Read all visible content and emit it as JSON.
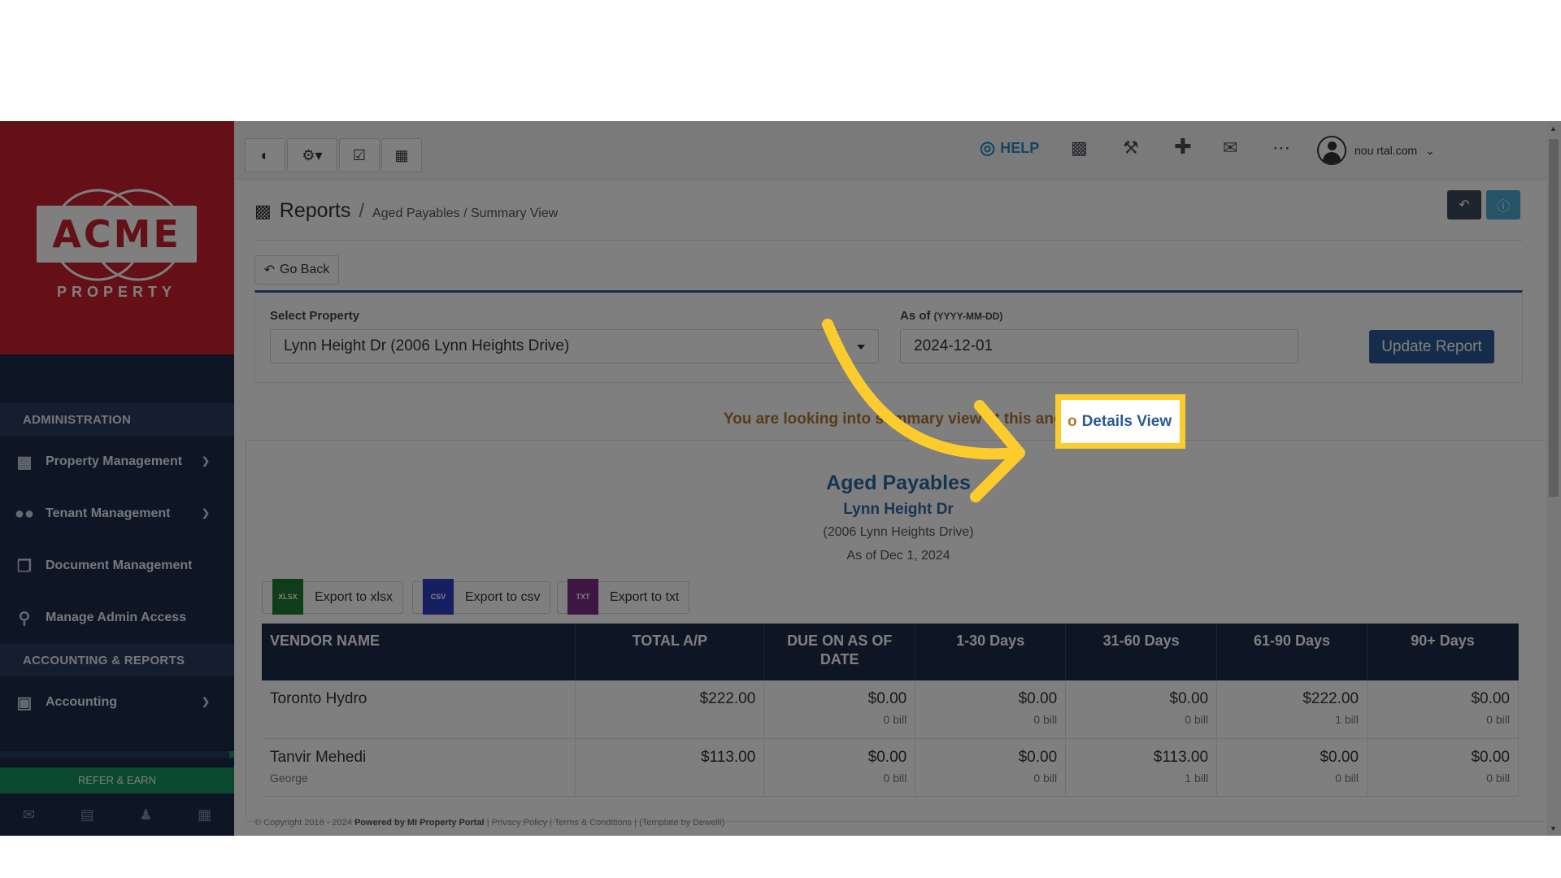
{
  "sidebar": {
    "logo_text": "ACME",
    "logo_sub": "PROPERTY",
    "section_admin": "ADMINISTRATION",
    "items_admin": [
      {
        "label": "Property Management",
        "icon": "building-icon",
        "expand": true
      },
      {
        "label": "Tenant Management",
        "icon": "users-icon",
        "expand": true
      },
      {
        "label": "Document Management",
        "icon": "documents-icon",
        "expand": false
      },
      {
        "label": "Manage Admin Access",
        "icon": "key-icon",
        "expand": false
      }
    ],
    "section_accounting": "ACCOUNTING & REPORTS",
    "items_accounting": [
      {
        "label": "Accounting",
        "icon": "money-icon",
        "expand": true
      }
    ],
    "refer_label": "REFER & EARN",
    "bottom_icons": [
      "mail-icon",
      "briefcase-icon",
      "user-icon",
      "calculator-icon"
    ]
  },
  "topbar": {
    "help_label": "HELP",
    "user_email_visible": "nou                        rtal.com"
  },
  "header": {
    "title": "Reports",
    "separator": "/",
    "crumb": "Aged Payables / Summary View"
  },
  "go_back_label": "Go Back",
  "filters": {
    "property_label": "Select Property",
    "property_value": "Lynn Height Dr (2006 Lynn Heights Drive)",
    "date_label": "As of",
    "date_hint": "(YYYY-MM-DD)",
    "date_value": "2024-12-01",
    "update_label": "Update Report"
  },
  "notice": {
    "text": "You are looking into summary view at this                  ange",
    "highlight_pre": "o",
    "highlight_link": "Details View"
  },
  "report": {
    "title": "Aged Payables",
    "property": "Lynn Height Dr",
    "address": "(2006 Lynn Heights Drive)",
    "as_of": "As of Dec 1, 2024",
    "exports": [
      {
        "label": "Export to xlsx",
        "icon_text": "XLSX",
        "color": "#1e7a35"
      },
      {
        "label": "Export to csv",
        "icon_text": "CSV",
        "color": "#2d3fc4"
      },
      {
        "label": "Export to txt",
        "icon_text": "TXT",
        "color": "#7a2d86"
      }
    ],
    "columns": [
      "VENDOR NAME",
      "TOTAL A/P",
      "DUE ON AS OF DATE",
      "1-30 Days",
      "31-60 Days",
      "61-90 Days",
      "90+ Days"
    ],
    "rows": [
      {
        "vendor": "Toronto Hydro",
        "vendor_sub": "",
        "total": "$222.00",
        "cells": [
          {
            "amount": "$0.00",
            "bills": "0 bill"
          },
          {
            "amount": "$0.00",
            "bills": "0 bill"
          },
          {
            "amount": "$0.00",
            "bills": "0 bill"
          },
          {
            "amount": "$222.00",
            "bills": "1 bill"
          },
          {
            "amount": "$0.00",
            "bills": "0 bill"
          }
        ]
      },
      {
        "vendor": "Tanvir Mehedi",
        "vendor_sub": "George",
        "total": "$113.00",
        "cells": [
          {
            "amount": "$0.00",
            "bills": "0 bill"
          },
          {
            "amount": "$0.00",
            "bills": "0 bill"
          },
          {
            "amount": "$113.00",
            "bills": "1 bill"
          },
          {
            "amount": "$0.00",
            "bills": "0 bill"
          },
          {
            "amount": "$0.00",
            "bills": "0 bill"
          }
        ]
      }
    ]
  },
  "footer": {
    "copyright": "© Copyright 2016 - 2024",
    "powered": "Powered by MI Property Portal",
    "links": "| Privacy Policy | Terms & Conditions |",
    "template": "(Template by Dewelli)"
  },
  "colors": {
    "sidebar_bg": "#1d2b48",
    "logo_red": "#c8202c",
    "primary": "#2a5b94",
    "highlight": "#fccc2e"
  }
}
